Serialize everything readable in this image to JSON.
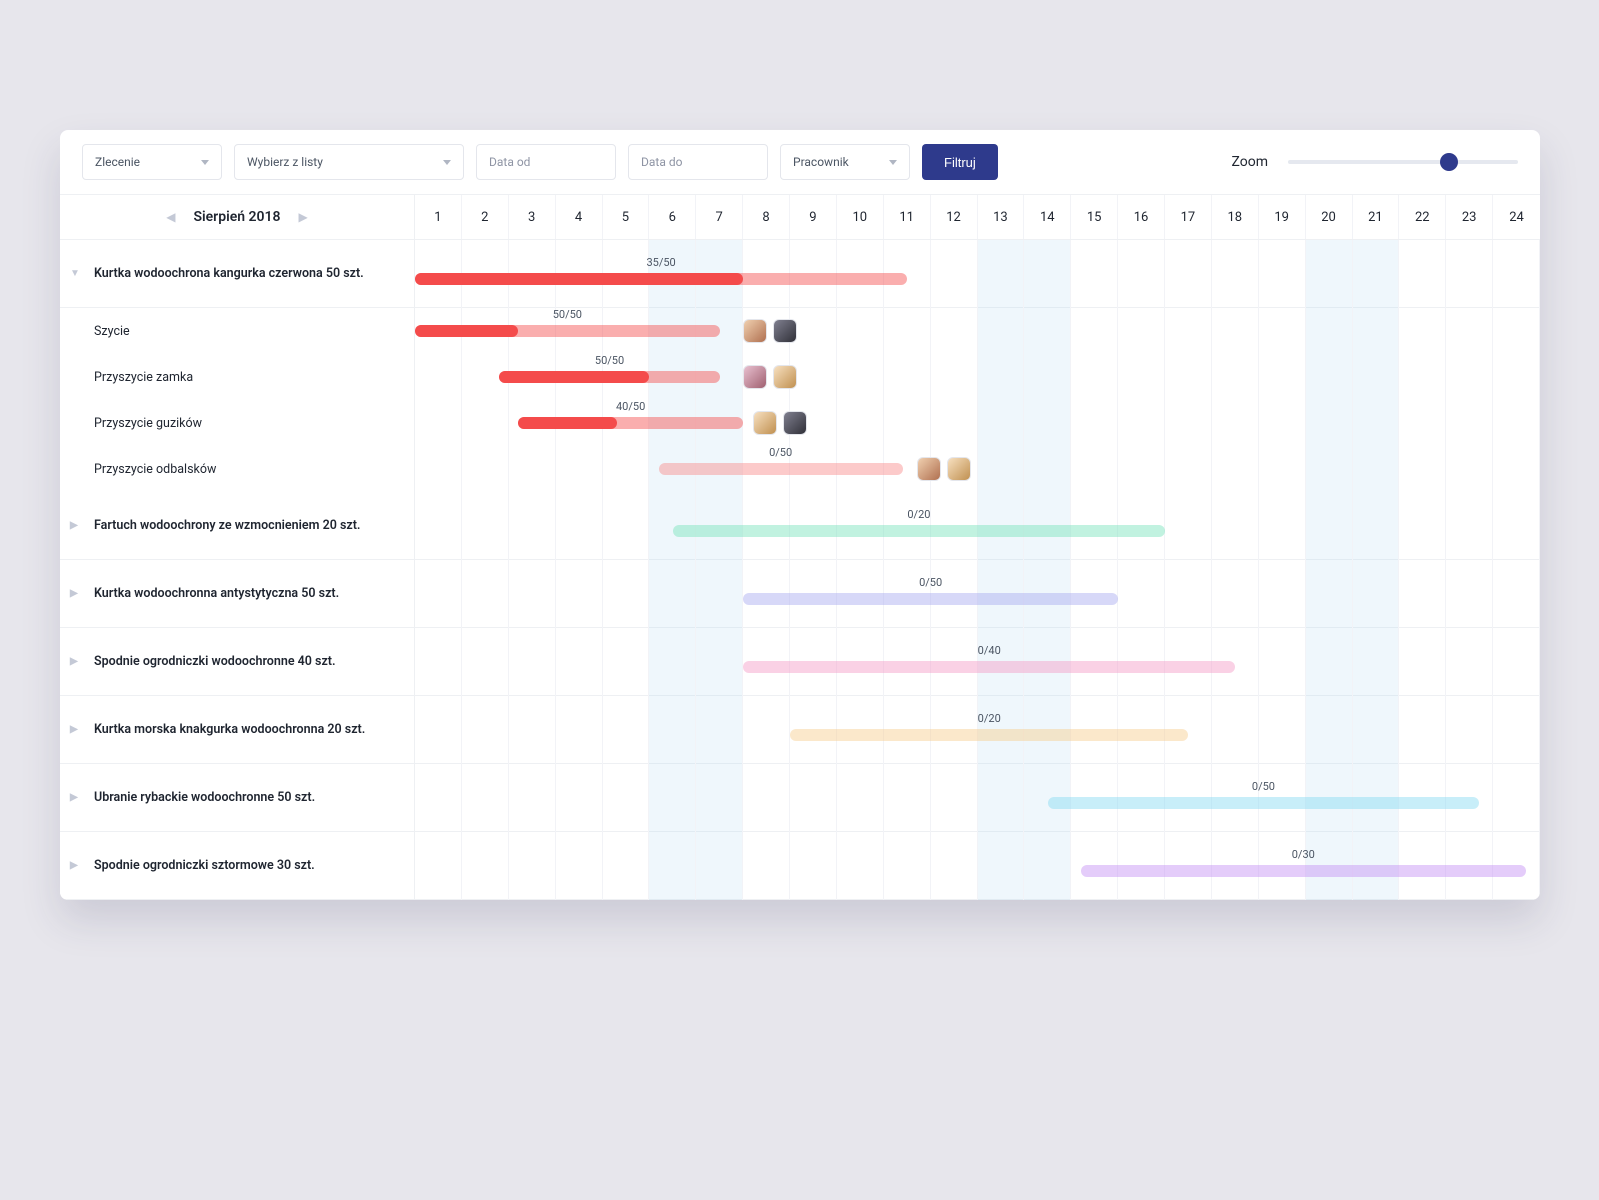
{
  "filters": {
    "zlecenie_label": "Zlecenie",
    "wybierz_label": "Wybierz z listy",
    "data_od_placeholder": "Data od",
    "data_do_placeholder": "Data do",
    "pracownik_label": "Pracownik",
    "button_label": "Filtruj",
    "zoom_label": "Zoom"
  },
  "month": {
    "label": "Sierpień 2018",
    "days": [
      "1",
      "2",
      "3",
      "4",
      "5",
      "6",
      "7",
      "8",
      "9",
      "10",
      "11",
      "12",
      "13",
      "14",
      "15",
      "16",
      "17",
      "18",
      "19",
      "20",
      "21",
      "22",
      "23",
      "24"
    ],
    "highlight_days": [
      6,
      7,
      13,
      14,
      20,
      21
    ]
  },
  "rows": [
    {
      "type": "parent",
      "expanded": true,
      "label": "Kurtka wodoochrona kangurka czerwona 50 szt.",
      "bar": {
        "start": 1,
        "end": 11.5,
        "progress_end": 8,
        "color": "#f44b4b",
        "label": "35/50"
      }
    },
    {
      "type": "sub",
      "label": "Szycie",
      "bar": {
        "start": 1,
        "end": 7.5,
        "progress_end": 3.2,
        "color": "#f44b4b",
        "label": "50/50"
      },
      "avatars": {
        "after": 8,
        "set": [
          "a1",
          "a2"
        ]
      }
    },
    {
      "type": "sub",
      "label": "Przyszycie zamka",
      "bar": {
        "start": 2.8,
        "end": 7.5,
        "progress_end": 6,
        "color": "#f44b4b",
        "label": "50/50"
      },
      "avatars": {
        "after": 8,
        "set": [
          "a3",
          "a4"
        ]
      }
    },
    {
      "type": "sub",
      "label": "Przyszycie guzików",
      "bar": {
        "start": 3.2,
        "end": 8,
        "progress_end": 5.3,
        "color": "#f44b4b",
        "label": "40/50"
      },
      "avatars": {
        "after": 8.2,
        "set": [
          "a4",
          "a2"
        ]
      }
    },
    {
      "type": "sub",
      "label": "Przyszycie odbalsków",
      "bar": {
        "start": 6.2,
        "end": 11.4,
        "progress_end": 6.2,
        "color": "#f88a8a",
        "label": "0/50"
      },
      "avatars": {
        "after": 11.7,
        "set": [
          "a1",
          "a4"
        ]
      }
    },
    {
      "type": "parent",
      "expanded": false,
      "label": "Fartuch wodoochrony ze wzmocnieniem 20 szt.",
      "bar": {
        "start": 6.5,
        "end": 17,
        "progress_end": 6.5,
        "color": "#76e3ba",
        "label": "0/20"
      }
    },
    {
      "type": "parent",
      "expanded": false,
      "label": "Kurtka wodoochronna antystytyczna 50 szt.",
      "bar": {
        "start": 8,
        "end": 16,
        "progress_end": 8,
        "color": "#a7a9ef",
        "label": "0/50"
      }
    },
    {
      "type": "parent",
      "expanded": false,
      "label": "Spodnie ogrodniczki wodoochronne 40 szt.",
      "bar": {
        "start": 8,
        "end": 18.5,
        "progress_end": 8,
        "color": "#f59ac5",
        "label": "0/40"
      }
    },
    {
      "type": "parent",
      "expanded": false,
      "label": "Kurtka morska knakgurka wodoochronna 20 szt.",
      "bar": {
        "start": 9,
        "end": 17.5,
        "progress_end": 9,
        "color": "#f6cd8b",
        "label": "0/20"
      }
    },
    {
      "type": "parent",
      "expanded": false,
      "label": "Ubranie rybackie wodoochronne 50 szt.",
      "bar": {
        "start": 14.5,
        "end": 23.7,
        "progress_end": 14.5,
        "color": "#85d9f2",
        "label": "0/50"
      }
    },
    {
      "type": "parent",
      "expanded": false,
      "label": "Spodnie ogrodniczki sztormowe 30 szt.",
      "bar": {
        "start": 15.2,
        "end": 24.7,
        "progress_end": 15.2,
        "color": "#c38df5",
        "label": "0/30"
      }
    }
  ]
}
